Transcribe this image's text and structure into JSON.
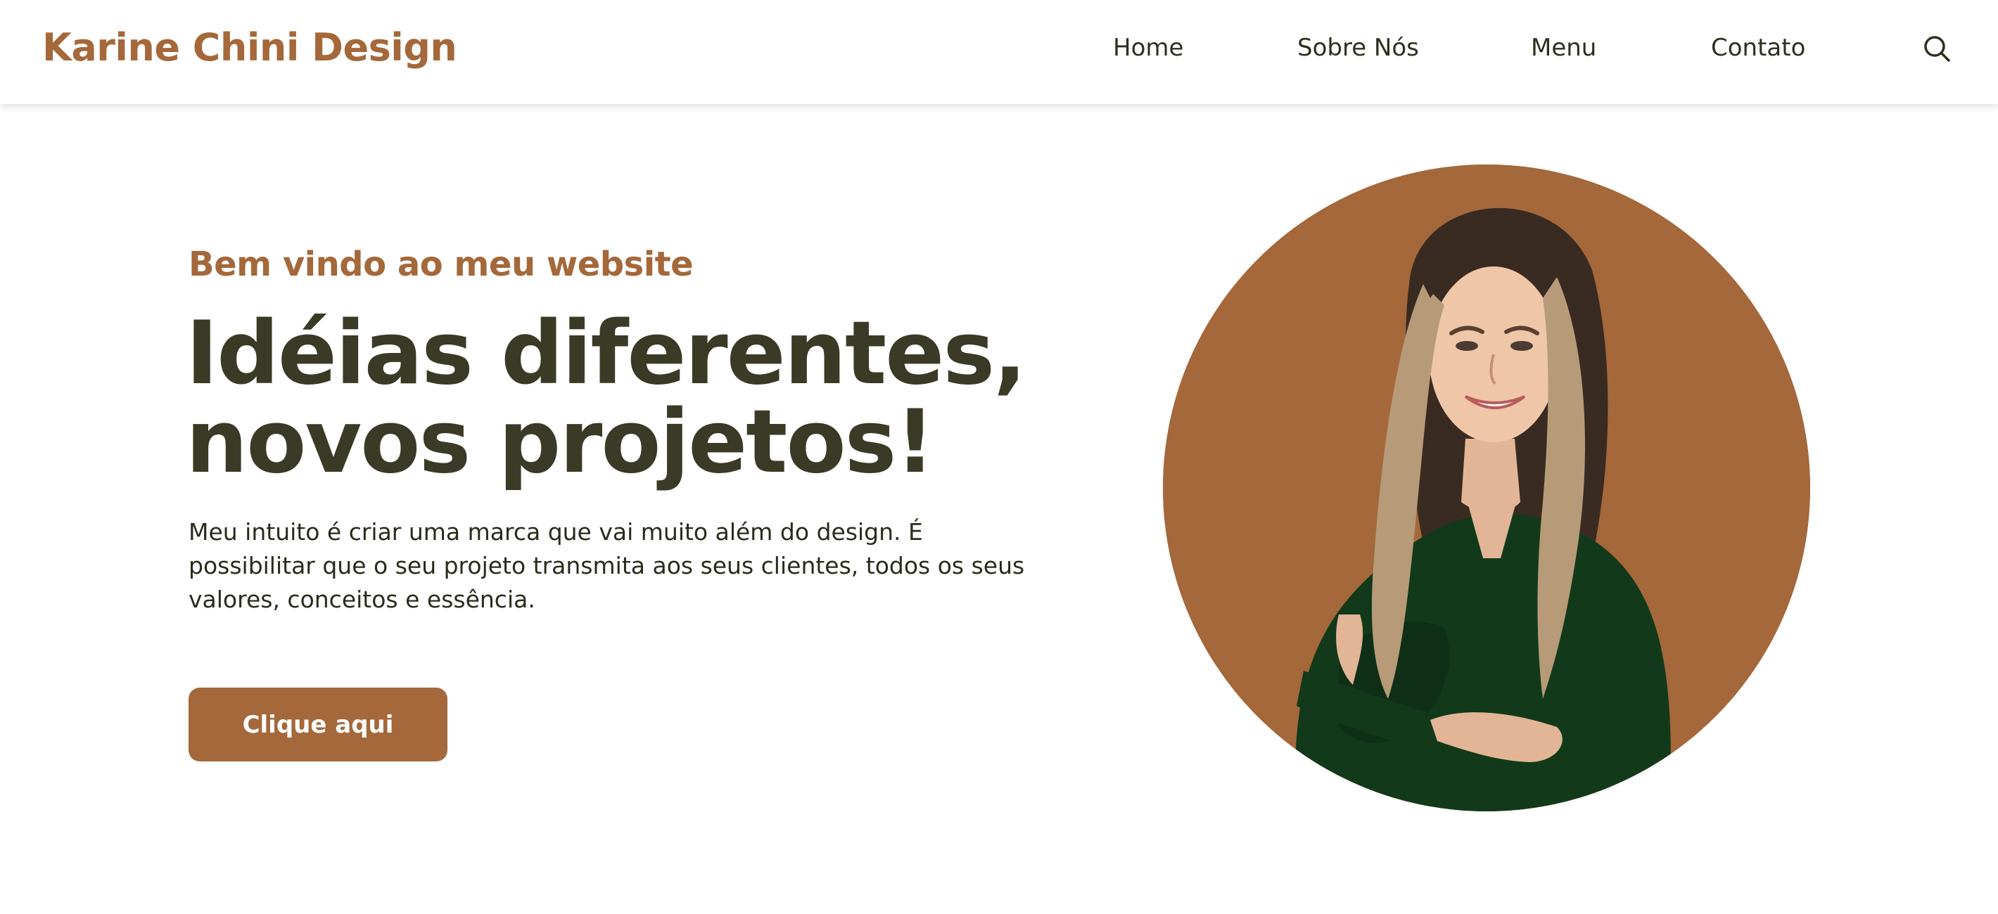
{
  "header": {
    "logo": "Karine Chini Design",
    "nav": {
      "home": "Home",
      "about": "Sobre Nós",
      "menu": "Menu",
      "contact": "Contato"
    },
    "search_icon": "search-icon"
  },
  "hero": {
    "subtitle": "Bem vindo ao meu website",
    "headline_line1": "Idéias diferentes,",
    "headline_line2": "novos projetos!",
    "description": "Meu intuito é criar uma marca que vai muito além do design. É possibilitar que o seu projeto transmita aos seus clientes, todos os seus valores, conceitos e essência.",
    "cta_label": "Clique aqui",
    "portrait_image": "portrait-photo"
  },
  "colors": {
    "brand": "#a4683a",
    "heading": "#3a3a26",
    "text": "#2b2b1c",
    "background": "#ffffff"
  }
}
